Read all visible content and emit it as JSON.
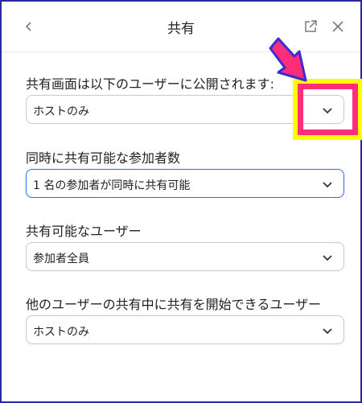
{
  "header": {
    "title": "共有",
    "back_icon": "chevron-left-icon",
    "popout_icon": "external-link-icon",
    "close_icon": "close-icon"
  },
  "fields": [
    {
      "label": "共有画面は以下のユーザーに公開されます:",
      "value": "ホストのみ"
    },
    {
      "label": "同時に共有可能な参加者数",
      "value": "1 名の参加者が同時に共有可能"
    },
    {
      "label": "共有可能なユーザー",
      "value": "参加者全員"
    },
    {
      "label": "他のユーザーの共有中に共有を開始できるユーザー",
      "value": "ホストのみ"
    }
  ],
  "annotation": {
    "arrow_color": "#ff2d7a",
    "arrow_outline": "#3b2bd4",
    "highlight_color": "#ff2d7a",
    "highlight_outline": "#ffff00"
  },
  "colors": {
    "frame_border": "#2a2aa0",
    "focus_border": "#2d6be0"
  }
}
